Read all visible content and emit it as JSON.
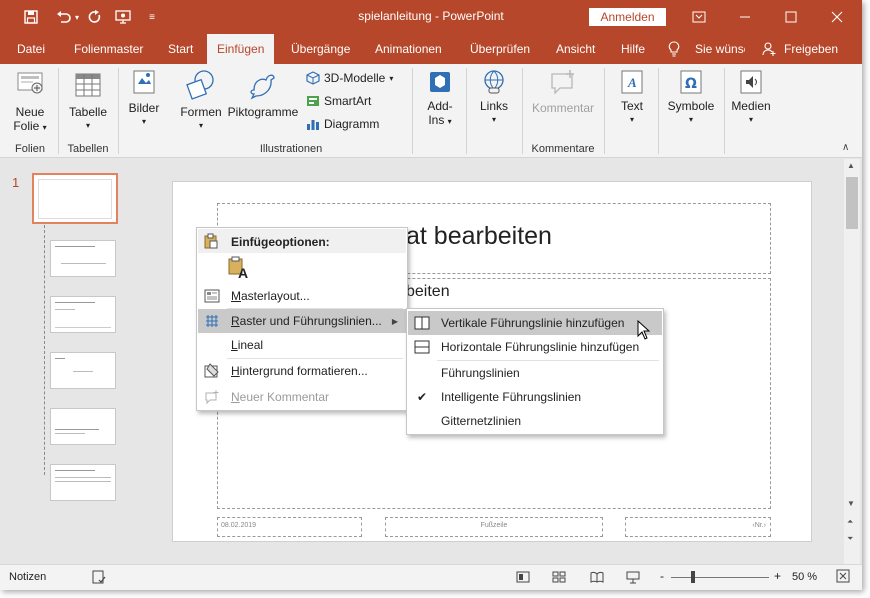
{
  "title_bar": {
    "title": "spielanleitung - PowerPoint",
    "signin": "Anmelden",
    "icons": [
      "save-icon",
      "undo-icon",
      "redo-icon",
      "present-icon",
      "customize-icon"
    ]
  },
  "tabs": [
    "Datei",
    "Folienmaster",
    "Start",
    "Einfügen",
    "Übergänge",
    "Animationen",
    "Überprüfen",
    "Ansicht",
    "Hilfe",
    "Sie wünsc",
    "Freigeben"
  ],
  "ribbon": {
    "buttons": {
      "neue_folie": [
        "Neue",
        "Folie"
      ],
      "tabelle": "Tabelle",
      "bilder": "Bilder",
      "formen": "Formen",
      "piktogramme": "Piktogramme",
      "modelle3d": "3D-Modelle",
      "smartart": "SmartArt",
      "diagramm": "Diagramm",
      "addins": [
        "Add-",
        "Ins"
      ],
      "links": "Links",
      "kommentar": "Kommentar",
      "text": "Text",
      "symbole": "Symbole",
      "medien": "Medien"
    },
    "groups": {
      "folien": "Folien",
      "tabellen": "Tabellen",
      "illustrationen": "Illustrationen",
      "kommentare": "Kommentare"
    }
  },
  "thumbnails": {
    "selected_number": "1",
    "count": 6
  },
  "slide": {
    "title_partial": "at bearbeiten",
    "subtitle_partial": "beiten",
    "footer_date": "08.02.2019",
    "footer_center": "Fußzeile",
    "footer_number": "‹Nr.›"
  },
  "context_menu": {
    "header": "Einfügeoptionen:",
    "paste_option_letter": "A",
    "items": [
      "Masterlayout...",
      "Raster und Führungslinien...",
      "Lineal",
      "Hintergrund formatieren...",
      "Neuer Kommentar"
    ],
    "underline_chars": [
      "M",
      "R",
      "L",
      "H",
      "N"
    ]
  },
  "submenu": {
    "items": [
      "Vertikale Führungslinie hinzufügen",
      "Horizontale Führungslinie hinzufügen",
      "Führungslinien",
      "Intelligente Führungslinien",
      "Gitternetzlinien"
    ],
    "checked": "Intelligente Führungslinien"
  },
  "status_bar": {
    "notes": "Notizen",
    "zoom": "50 %",
    "zoom_minus": "-",
    "zoom_plus": "+"
  },
  "colors": {
    "accent": "#b7472a",
    "menu_hover": "#c9c9c9"
  }
}
